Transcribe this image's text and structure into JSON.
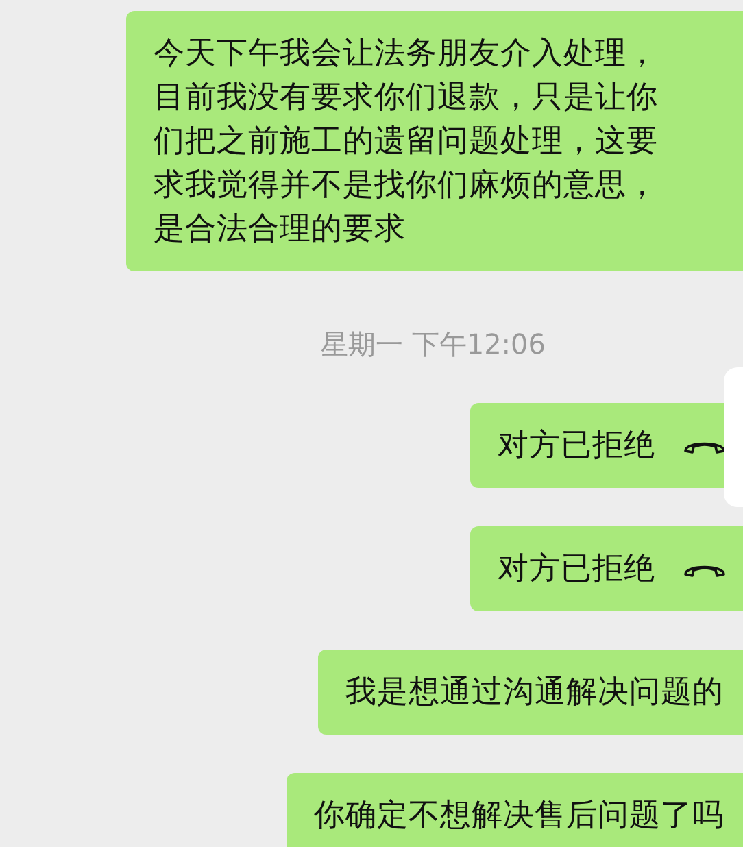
{
  "messages": [
    {
      "kind": "text",
      "text": "今天下午我会让法务朋友介入处理，目前我没有要求你们退款，只是让你们把之前施工的遗留问题处理，这要求我觉得并不是找你们麻烦的意思，是合法合理的要求"
    },
    {
      "kind": "time",
      "text": "星期一 下午12:06"
    },
    {
      "kind": "call",
      "text": "对方已拒绝"
    },
    {
      "kind": "call",
      "text": "对方已拒绝"
    },
    {
      "kind": "text",
      "text": "我是想通过沟通解决问题的"
    },
    {
      "kind": "text",
      "text": "你确定不想解决售后问题了吗"
    }
  ]
}
